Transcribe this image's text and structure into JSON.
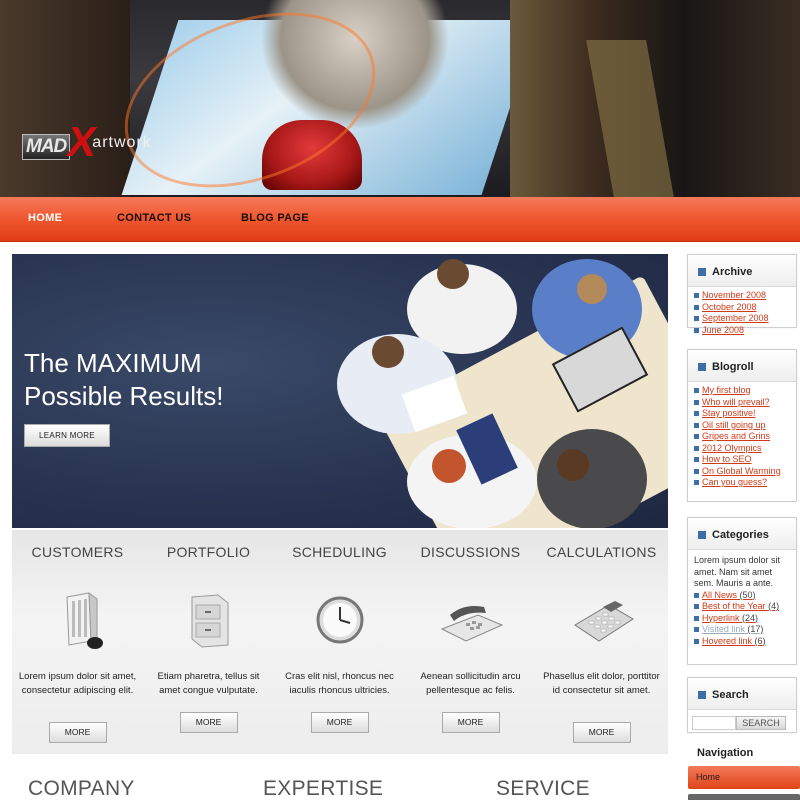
{
  "logo": {
    "part1": "MAD",
    "part2": "X",
    "part3": "artwork"
  },
  "nav": {
    "home": "HOME",
    "contact": "CONTACT US",
    "blog": "BLOG PAGE"
  },
  "hero": {
    "title_line1": "The MAXIMUM",
    "title_line2": "Possible Results!",
    "button": "LEARN MORE"
  },
  "features": [
    {
      "title": "CUSTOMERS",
      "icon": "building-icon",
      "text": "Lorem ipsum dolor sit amet, consectetur adipiscing elit.",
      "more": "MORE"
    },
    {
      "title": "PORTFOLIO",
      "icon": "file-cabinet-icon",
      "text": "Etiam pharetra, tellus sit amet congue vulputate.",
      "more": "MORE"
    },
    {
      "title": "SCHEDULING",
      "icon": "clock-icon",
      "text": "Cras elit nisl, rhoncus nec iaculis rhoncus ultricies.",
      "more": "MORE"
    },
    {
      "title": "DISCUSSIONS",
      "icon": "telephone-icon",
      "text": "Aenean sollicitudin arcu pellentesque ac felis.",
      "more": "MORE"
    },
    {
      "title": "CALCULATIONS",
      "icon": "calculator-icon",
      "text": "Phasellus elit dolor, porttitor id consectetur sit amet.",
      "more": "MORE"
    }
  ],
  "lower": {
    "col1": "COMPANY",
    "col2": "EXPERTISE",
    "col3": "SERVICE"
  },
  "sidebar": {
    "archive": {
      "title": "Archive",
      "items": [
        "November 2008",
        "October 2008",
        "September 2008",
        "June 2008"
      ]
    },
    "blogroll": {
      "title": "Blogroll",
      "items": [
        "My first blog",
        "Who will prevail?",
        "Stay positive!",
        "Oil still going up",
        "Gripes and Grins",
        "2012 Olympics",
        "How to SEO",
        "On Global Warming",
        "Can you guess?"
      ]
    },
    "categories": {
      "title": "Categories",
      "text": "Lorem ipsum dolor sit amet. Nam sit amet sem. Mauris a ante.",
      "items": [
        {
          "label": "All News",
          "count": "(50)"
        },
        {
          "label": "Best of the Year",
          "count": "(4)"
        },
        {
          "label": "Hyperlink",
          "count": "(24)"
        },
        {
          "label": "Visited link",
          "count": "(17)"
        },
        {
          "label": "Hovered link",
          "count": "(6)"
        }
      ]
    },
    "search": {
      "title": "Search",
      "button": "SEARCH",
      "placeholder": ""
    },
    "navigation": {
      "title": "Navigation",
      "home": "Home"
    }
  },
  "colors": {
    "accent": "#f05a32",
    "link": "#d03a1a",
    "bullet": "#3e6ea8"
  }
}
